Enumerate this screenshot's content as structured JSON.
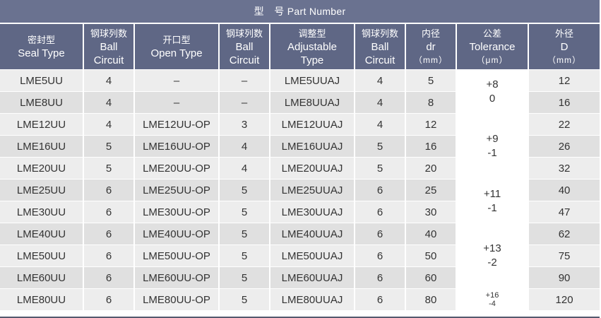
{
  "title": "型　号 Part Number",
  "headers": [
    {
      "cn": "密封型",
      "en": "Seal Type",
      "en2": ""
    },
    {
      "cn": "钢球列数",
      "en": "Ball",
      "en2": "Circuit"
    },
    {
      "cn": "开口型",
      "en": "Open Type",
      "en2": ""
    },
    {
      "cn": "钢球列数",
      "en": "Ball",
      "en2": "Circuit"
    },
    {
      "cn": "调整型",
      "en": "Adjustable",
      "en2": "Type"
    },
    {
      "cn": "钢球列数",
      "en": "Ball",
      "en2": "Circuit"
    },
    {
      "cn": "内径",
      "en": "dr",
      "en2": "（mm）"
    },
    {
      "cn": "公差",
      "en": "Tolerance",
      "en2": "（μm）"
    },
    {
      "cn": "外径",
      "en": "D",
      "en2": "（mm）"
    }
  ],
  "rows": [
    [
      "LME5UU",
      "4",
      "–",
      "–",
      "LME5UUAJ",
      "4",
      "5",
      "12"
    ],
    [
      "LME8UU",
      "4",
      "–",
      "–",
      "LME8UUAJ",
      "4",
      "8",
      "16"
    ],
    [
      "LME12UU",
      "4",
      "LME12UU-OP",
      "3",
      "LME12UUAJ",
      "4",
      "12",
      "22"
    ],
    [
      "LME16UU",
      "5",
      "LME16UU-OP",
      "4",
      "LME16UUAJ",
      "5",
      "16",
      "26"
    ],
    [
      "LME20UU",
      "5",
      "LME20UU-OP",
      "4",
      "LME20UUAJ",
      "5",
      "20",
      "32"
    ],
    [
      "LME25UU",
      "6",
      "LME25UU-OP",
      "5",
      "LME25UUAJ",
      "6",
      "25",
      "40"
    ],
    [
      "LME30UU",
      "6",
      "LME30UU-OP",
      "5",
      "LME30UUAJ",
      "6",
      "30",
      "47"
    ],
    [
      "LME40UU",
      "6",
      "LME40UU-OP",
      "5",
      "LME40UUAJ",
      "6",
      "40",
      "62"
    ],
    [
      "LME50UU",
      "6",
      "LME50UU-OP",
      "5",
      "LME50UUAJ",
      "6",
      "50",
      "75"
    ],
    [
      "LME60UU",
      "6",
      "LME60UU-OP",
      "5",
      "LME60UUAJ",
      "6",
      "60",
      "90"
    ],
    [
      "LME80UU",
      "6",
      "LME80UU-OP",
      "5",
      "LME80UUAJ",
      "6",
      "80",
      "120"
    ]
  ],
  "tolerances": [
    {
      "upper": "+8",
      "lower": "0"
    },
    {
      "upper": "+9",
      "lower": "-1"
    },
    {
      "upper": "+11",
      "lower": "-1"
    },
    {
      "upper": "+13",
      "lower": "-2"
    },
    {
      "upper": "+16",
      "lower": "-4"
    }
  ]
}
